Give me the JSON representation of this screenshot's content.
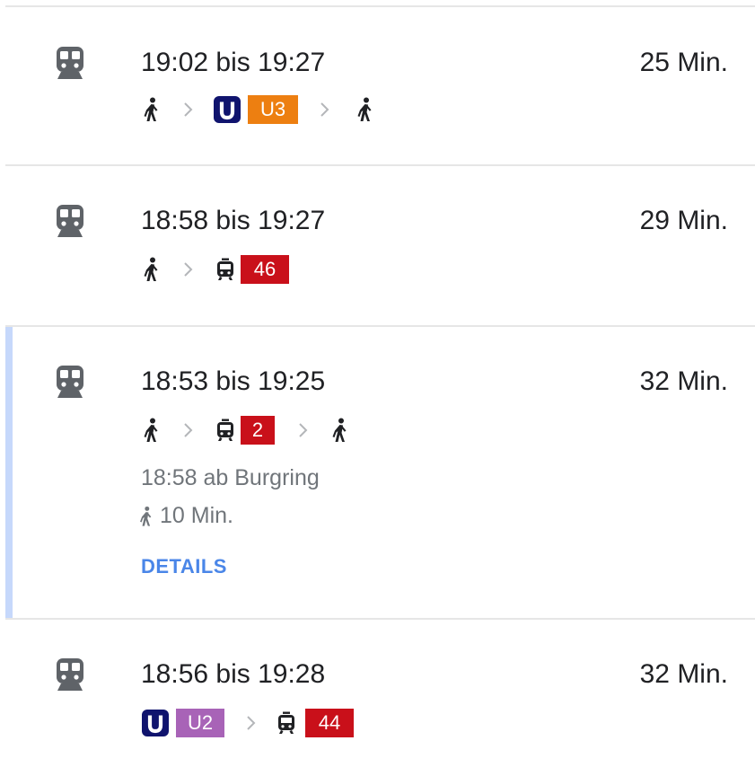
{
  "colors": {
    "ubahn_logo": "#10146e",
    "u3": "#ed7f11",
    "u2": "#a863b7",
    "tram": "#c9101a",
    "accent": "#c6d8fb",
    "link": "#4a86e8"
  },
  "routes": [
    {
      "times": "19:02 bis 19:27",
      "duration": "25 Min.",
      "mode_icon": "train-icon",
      "lines": {
        "u_logo": "U",
        "line": "U3"
      }
    },
    {
      "times": "18:58 bis 19:27",
      "duration": "29 Min.",
      "mode_icon": "train-icon",
      "lines": {
        "line": "46"
      }
    },
    {
      "times": "18:53 bis 19:25",
      "duration": "32 Min.",
      "mode_icon": "train-icon",
      "selected": true,
      "lines": {
        "line": "2"
      },
      "departure": "18:58 ab Burgring",
      "walk": "10 Min.",
      "details_label": "DETAILS"
    },
    {
      "times": "18:56 bis 19:28",
      "duration": "32 Min.",
      "mode_icon": "train-icon",
      "lines": {
        "u_logo": "U",
        "line1": "U2",
        "line2": "44"
      }
    }
  ]
}
